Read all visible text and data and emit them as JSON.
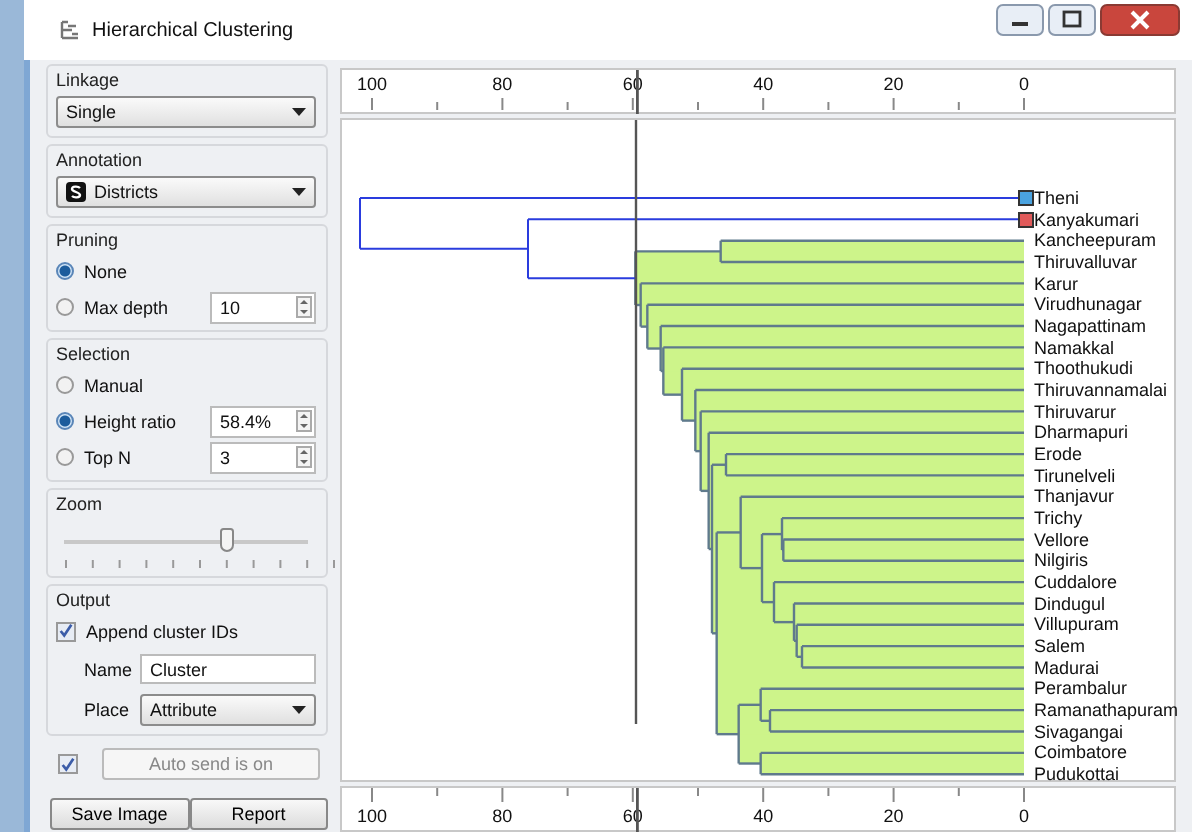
{
  "window": {
    "title": "Hierarchical Clustering"
  },
  "linkage": {
    "label": "Linkage",
    "value": "Single"
  },
  "annotation": {
    "label": "Annotation",
    "value": "Districts"
  },
  "pruning": {
    "label": "Pruning",
    "options": [
      {
        "label": "None",
        "selected": true
      },
      {
        "label": "Max depth",
        "selected": false,
        "value": "10"
      }
    ]
  },
  "selection": {
    "label": "Selection",
    "options": [
      {
        "label": "Manual",
        "selected": false
      },
      {
        "label": "Height ratio",
        "selected": true,
        "value": "58.4%"
      },
      {
        "label": "Top N",
        "selected": false,
        "value": "3"
      }
    ]
  },
  "zoom": {
    "label": "Zoom",
    "level": 0.66
  },
  "output": {
    "label": "Output",
    "append": {
      "label": "Append cluster IDs",
      "checked": true
    },
    "name": {
      "label": "Name",
      "value": "Cluster"
    },
    "place": {
      "label": "Place",
      "value": "Attribute"
    }
  },
  "auto_send": {
    "checked": true,
    "label": "Auto send is on",
    "disabled": true
  },
  "buttons": [
    "Save Image",
    "Report"
  ],
  "top_axis_ticks": [
    "100",
    "80",
    "60",
    "40",
    "20",
    "0"
  ],
  "bottom_axis_ticks": [
    "100",
    "80",
    "60",
    "40",
    "20",
    "0"
  ],
  "leaves": [
    {
      "label": "Theni",
      "color": "#4aa3e0"
    },
    {
      "label": "Kanyakumari",
      "color": "#e05a5a"
    },
    {
      "label": "Kancheepuram"
    },
    {
      "label": "Thiruvalluvar"
    },
    {
      "label": "Karur"
    },
    {
      "label": "Virudhunagar"
    },
    {
      "label": "Nagapattinam"
    },
    {
      "label": "Namakkal"
    },
    {
      "label": "Thoothukudi"
    },
    {
      "label": "Thiruvannamalai"
    },
    {
      "label": "Thiruvarur"
    },
    {
      "label": "Dharmapuri"
    },
    {
      "label": "Erode"
    },
    {
      "label": "Tirunelveli"
    },
    {
      "label": "Thanjavur"
    },
    {
      "label": "Trichy"
    },
    {
      "label": "Vellore"
    },
    {
      "label": "Nilgiris"
    },
    {
      "label": "Cuddalore"
    },
    {
      "label": "Dindugul"
    },
    {
      "label": "Villupuram"
    },
    {
      "label": "Salem"
    },
    {
      "label": "Madurai"
    },
    {
      "label": "Perambalur"
    },
    {
      "label": "Ramanathapuram"
    },
    {
      "label": "Sivagangai"
    },
    {
      "label": "Coimbatore"
    },
    {
      "label": "Pudukottai"
    }
  ]
}
